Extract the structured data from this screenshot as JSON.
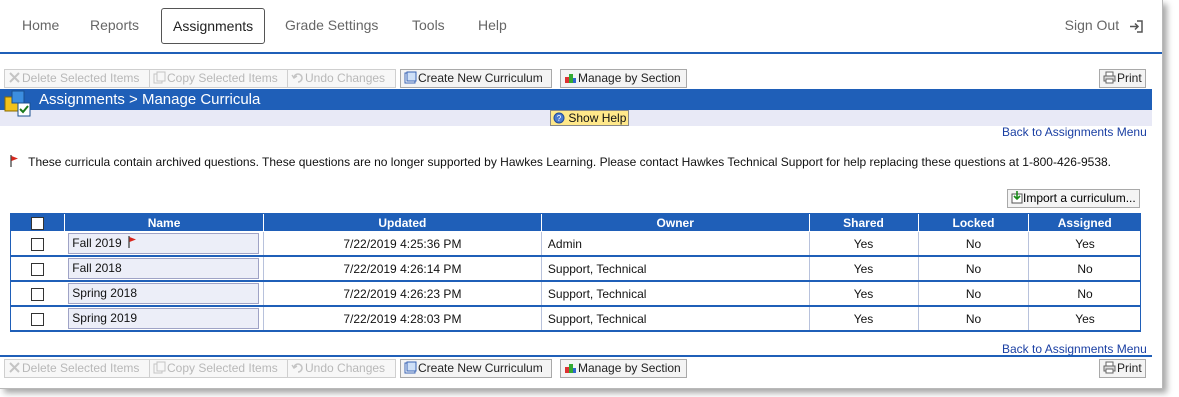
{
  "nav": {
    "items": [
      "Home",
      "Reports",
      "Assignments",
      "Grade Settings",
      "Tools",
      "Help"
    ],
    "active": "Assignments",
    "sign_out": "Sign Out"
  },
  "toolbar": {
    "delete": "Delete Selected Items",
    "copy": "Copy Selected Items",
    "undo": "Undo Changes",
    "create": "Create New Curriculum",
    "manage": "Manage by Section",
    "print": "Print"
  },
  "header": {
    "title": "Assignments > Manage Curricula",
    "show_help": "Show Help",
    "back_link": "Back to Assignments Menu"
  },
  "notice": "These curricula contain archived questions. These questions are no longer supported by Hawkes Learning. Please contact Hawkes Technical Support for help replacing these questions at 1-800-426-9538.",
  "import_button": "Import a curriculum...",
  "table": {
    "headers": [
      "Name",
      "Updated",
      "Owner",
      "Shared",
      "Locked",
      "Assigned"
    ],
    "rows": [
      {
        "name": "Fall 2019",
        "flag": true,
        "updated": "7/22/2019 4:25:36 PM",
        "owner": "Admin",
        "shared": "Yes",
        "locked": "No",
        "assigned": "Yes"
      },
      {
        "name": "Fall 2018",
        "flag": false,
        "updated": "7/22/2019 4:26:14 PM",
        "owner": "Support, Technical",
        "shared": "Yes",
        "locked": "No",
        "assigned": "No"
      },
      {
        "name": "Spring 2018",
        "flag": false,
        "updated": "7/22/2019 4:26:23 PM",
        "owner": "Support, Technical",
        "shared": "Yes",
        "locked": "No",
        "assigned": "No"
      },
      {
        "name": "Spring 2019",
        "flag": false,
        "updated": "7/22/2019 4:28:03 PM",
        "owner": "Support, Technical",
        "shared": "Yes",
        "locked": "No",
        "assigned": "Yes"
      }
    ]
  },
  "colors": {
    "accent": "#1f5fb8",
    "flag": "#d9261c",
    "help_bg": "#ffe88a"
  }
}
